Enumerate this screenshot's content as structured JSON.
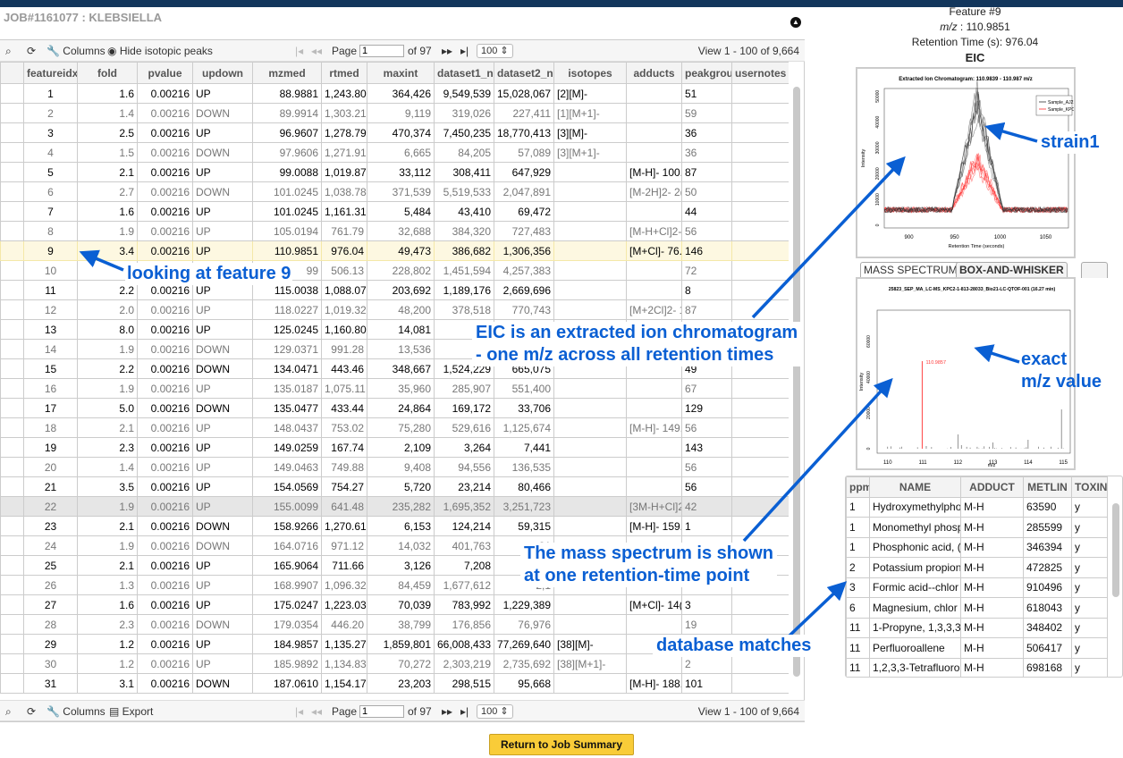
{
  "job_title": "JOB#1161077 : KLEBSIELLA",
  "toolbar": {
    "columns": "Columns",
    "hide_iso": "Hide isotopic peaks",
    "export": "Export",
    "page_label": "Page",
    "page_value": "1",
    "of_pages": "of 97",
    "rows_per_page": "100",
    "view": "View 1 - 100 of 9,664"
  },
  "columns": [
    "featureidx",
    "fold",
    "pvalue",
    "updown",
    "mzmed",
    "rtmed",
    "maxint",
    "dataset1_n",
    "dataset2_n",
    "isotopes",
    "adducts",
    "peakgrou",
    "usernotes"
  ],
  "rows": [
    [
      "1",
      "1.6",
      "0.00216",
      "UP",
      "88.9881",
      "1,243.80",
      "364,426",
      "9,549,539",
      "15,028,067",
      "[2][M]-",
      "",
      "51",
      ""
    ],
    [
      "2",
      "1.4",
      "0.00216",
      "DOWN",
      "89.9914",
      "1,303.21",
      "9,119",
      "319,026",
      "227,411",
      "[1][M+1]-",
      "",
      "59",
      ""
    ],
    [
      "3",
      "2.5",
      "0.00216",
      "UP",
      "96.9607",
      "1,278.79",
      "470,374",
      "7,450,235",
      "18,770,413",
      "[3][M]-",
      "",
      "36",
      ""
    ],
    [
      "4",
      "1.5",
      "0.00216",
      "DOWN",
      "97.9606",
      "1,271.91",
      "6,665",
      "84,205",
      "57,089",
      "[3][M+1]-",
      "",
      "36",
      ""
    ],
    [
      "5",
      "2.1",
      "0.00216",
      "UP",
      "99.0088",
      "1,019.87",
      "33,112",
      "308,411",
      "647,929",
      "",
      "[M-H]- 100.",
      "87",
      ""
    ],
    [
      "6",
      "2.7",
      "0.00216",
      "DOWN",
      "101.0245",
      "1,038.78",
      "371,539",
      "5,519,533",
      "2,047,891",
      "",
      "[M-2H]2- 2(",
      "50",
      ""
    ],
    [
      "7",
      "1.6",
      "0.00216",
      "UP",
      "101.0245",
      "1,161.31",
      "5,484",
      "43,410",
      "69,472",
      "",
      "",
      "44",
      ""
    ],
    [
      "8",
      "1.9",
      "0.00216",
      "UP",
      "105.0194",
      "761.79",
      "32,688",
      "384,320",
      "727,483",
      "",
      "[M-H+Cl]2-",
      "56",
      ""
    ],
    [
      "9",
      "3.4",
      "0.00216",
      "UP",
      "110.9851",
      "976.04",
      "49,473",
      "386,682",
      "1,306,356",
      "",
      "[M+Cl]- 76.",
      "146",
      ""
    ],
    [
      "10",
      "",
      "",
      "",
      "99",
      "506.13",
      "228,802",
      "1,451,594",
      "4,257,383",
      "",
      "",
      "72",
      ""
    ],
    [
      "11",
      "2.2",
      "0.00216",
      "UP",
      "115.0038",
      "1,088.07",
      "203,692",
      "1,189,176",
      "2,669,696",
      "",
      "",
      "8",
      ""
    ],
    [
      "12",
      "2.0",
      "0.00216",
      "UP",
      "118.0227",
      "1,019.32",
      "48,200",
      "378,518",
      "770,743",
      "",
      "[M+2Cl]2- 1",
      "87",
      ""
    ],
    [
      "13",
      "8.0",
      "0.00216",
      "UP",
      "125.0245",
      "1,160.80",
      "14,081",
      "21",
      "",
      "",
      "",
      "",
      ""
    ],
    [
      "14",
      "1.9",
      "0.00216",
      "DOWN",
      "129.0371",
      "991.28",
      "13,536",
      "387",
      "",
      "",
      "",
      "",
      ""
    ],
    [
      "15",
      "2.2",
      "0.00216",
      "DOWN",
      "134.0471",
      "443.46",
      "348,667",
      "1,524,229",
      "665,075",
      "",
      "",
      "49",
      ""
    ],
    [
      "16",
      "1.9",
      "0.00216",
      "UP",
      "135.0187",
      "1,075.11",
      "35,960",
      "285,907",
      "551,400",
      "",
      "",
      "67",
      ""
    ],
    [
      "17",
      "5.0",
      "0.00216",
      "DOWN",
      "135.0477",
      "433.44",
      "24,864",
      "169,172",
      "33,706",
      "",
      "",
      "129",
      ""
    ],
    [
      "18",
      "2.1",
      "0.00216",
      "UP",
      "148.0437",
      "753.02",
      "75,280",
      "529,616",
      "1,125,674",
      "",
      "[M-H]- 149.",
      "56",
      ""
    ],
    [
      "19",
      "2.3",
      "0.00216",
      "UP",
      "149.0259",
      "167.74",
      "2,109",
      "3,264",
      "7,441",
      "",
      "",
      "143",
      ""
    ],
    [
      "20",
      "1.4",
      "0.00216",
      "UP",
      "149.0463",
      "749.88",
      "9,408",
      "94,556",
      "136,535",
      "",
      "",
      "56",
      ""
    ],
    [
      "21",
      "3.5",
      "0.00216",
      "UP",
      "154.0569",
      "754.27",
      "5,720",
      "23,214",
      "80,466",
      "",
      "",
      "56",
      ""
    ],
    [
      "22",
      "1.9",
      "0.00216",
      "UP",
      "155.0099",
      "641.48",
      "235,282",
      "1,695,352",
      "3,251,723",
      "",
      "[3M-H+Cl]2",
      "42",
      ""
    ],
    [
      "23",
      "2.1",
      "0.00216",
      "DOWN",
      "158.9266",
      "1,270.61",
      "6,153",
      "124,214",
      "59,315",
      "",
      "[M-H]- 159.",
      "1",
      ""
    ],
    [
      "24",
      "1.9",
      "0.00216",
      "DOWN",
      "164.0716",
      "971.12",
      "14,032",
      "401,763",
      "21",
      "",
      "",
      "",
      ""
    ],
    [
      "25",
      "2.1",
      "0.00216",
      "UP",
      "165.9064",
      "711.66",
      "3,126",
      "7,208",
      "",
      "",
      "",
      "",
      ""
    ],
    [
      "26",
      "1.3",
      "0.00216",
      "UP",
      "168.9907",
      "1,096.32",
      "84,459",
      "1,677,612",
      "2,1",
      "",
      "",
      "",
      ""
    ],
    [
      "27",
      "1.6",
      "0.00216",
      "UP",
      "175.0247",
      "1,223.03",
      "70,039",
      "783,992",
      "1,229,389",
      "",
      "[M+Cl]- 14(",
      "3",
      ""
    ],
    [
      "28",
      "2.3",
      "0.00216",
      "DOWN",
      "179.0354",
      "446.20",
      "38,799",
      "176,856",
      "76,976",
      "",
      "",
      "19",
      ""
    ],
    [
      "29",
      "1.2",
      "0.00216",
      "UP",
      "184.9857",
      "1,135.27",
      "1,859,801",
      "66,008,433",
      "77,269,640",
      "[38][M]-",
      "",
      "",
      ""
    ],
    [
      "30",
      "1.2",
      "0.00216",
      "UP",
      "185.9892",
      "1,134.83",
      "70,272",
      "2,303,219",
      "2,735,692",
      "[38][M+1]-",
      "",
      "2",
      ""
    ],
    [
      "31",
      "3.1",
      "0.00216",
      "DOWN",
      "187.0610",
      "1,154.17",
      "23,203",
      "298,515",
      "95,668",
      "",
      "[M-H]- 188.",
      "101",
      ""
    ]
  ],
  "feature": {
    "title": "Feature #9",
    "mz_label": "m/z",
    "mz_value": ": 110.9851",
    "rt": "Retention Time (s): 976.04",
    "section": "EIC"
  },
  "eic": {
    "title": "Extracted Ion Chromatogram: 110.9839 - 110.987 m/z",
    "xlabel": "Retention Time (seconds)",
    "ylabel": "Intensity",
    "xticks": [
      "900",
      "950",
      "1000",
      "1050"
    ],
    "yticks": [
      "0",
      "10000",
      "20000",
      "30000",
      "40000",
      "50000"
    ],
    "legend": [
      "Sample_AJ218",
      "Sample_KPC2"
    ],
    "colors": [
      "#333333",
      "#ff2a2a"
    ]
  },
  "tabs": [
    "MASS SPECTRUM",
    "BOX-AND-WHISKER",
    ""
  ],
  "spectrum": {
    "title": "25823_SEP_MA_LC-MS_KPC2-1-813-28033_Bio21-LC-QTOF-001 (16.27 min)",
    "peak_label": "110.9857",
    "xlabel": "m/z",
    "ylabel": "Intensity",
    "xticks": [
      "110",
      "111",
      "112",
      "113",
      "114",
      "115"
    ],
    "yticks": [
      "0",
      "20000",
      "40000",
      "60000"
    ]
  },
  "db": {
    "columns": [
      "ppm",
      "NAME",
      "ADDUCT",
      "METLIN",
      "TOXIN"
    ],
    "rows": [
      [
        "1",
        "Hydroxymethylpho",
        "M-H",
        "63590",
        "y"
      ],
      [
        "1",
        "Monomethyl phosp",
        "M-H",
        "285599",
        "y"
      ],
      [
        "1",
        "Phosphonic acid, (",
        "M-H",
        "346394",
        "y"
      ],
      [
        "2",
        "Potassium propion",
        "M-H",
        "472825",
        "y"
      ],
      [
        "3",
        "Formic acid--chlor",
        "M-H",
        "910496",
        "y"
      ],
      [
        "6",
        "Magnesium, chlor",
        "M-H",
        "618043",
        "y"
      ],
      [
        "11",
        "1-Propyne, 1,3,3,3",
        "M-H",
        "348402",
        "y"
      ],
      [
        "11",
        "Perfluoroallene",
        "M-H",
        "506417",
        "y"
      ],
      [
        "11",
        "1,2,3,3-Tetrafluoro",
        "M-H",
        "698168",
        "y"
      ]
    ]
  },
  "annotations": {
    "strain": "strain1",
    "feature9": "looking at feature 9",
    "eic1": "EIC is an extracted ion chromatogram",
    "eic2": "- one m/z across all retention times",
    "exact1": "exact",
    "exact2": "m/z value",
    "ms1": "The mass spectrum is shown",
    "ms2": "at one retention-time point",
    "dbm": "database matches"
  },
  "return_button": "Return to Job Summary"
}
